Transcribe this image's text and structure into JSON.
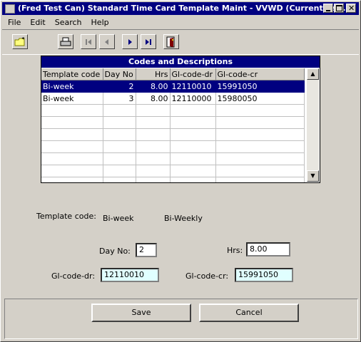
{
  "window": {
    "title": "(Fred Test Can) Standard Time Card Template Maint - VVWD (Current Us..."
  },
  "menu": [
    {
      "label": "File"
    },
    {
      "label": "Edit"
    },
    {
      "label": "Search"
    },
    {
      "label": "Help"
    }
  ],
  "toolbar": {
    "icons": [
      "open-folder-icon",
      "print-icon",
      "first-record-icon",
      "previous-record-icon",
      "next-record-icon",
      "last-record-icon",
      "exit-door-icon"
    ]
  },
  "grid": {
    "title": "Codes and Descriptions",
    "columns": [
      "Template code",
      "Day No",
      "Hrs",
      "Gl-code-dr",
      "Gl-code-cr"
    ],
    "rows": [
      {
        "template_code": "Bi-week",
        "day_no": "2",
        "hrs": "8.00",
        "gl_dr": "12110010",
        "gl_cr": "15991050",
        "selected": true
      },
      {
        "template_code": "Bi-week",
        "day_no": "3",
        "hrs": "8.00",
        "gl_dr": "12110000",
        "gl_cr": "15980050",
        "selected": false
      }
    ]
  },
  "form": {
    "template_code_label": "Template code:",
    "template_code_value": "Bi-week",
    "template_code_desc": "Bi-Weekly",
    "day_no_label": "Day No:",
    "day_no_value": "2",
    "hrs_label": "Hrs:",
    "hrs_value": "8.00",
    "gl_dr_label": "Gl-code-dr:",
    "gl_dr_value": "12110010",
    "gl_cr_label": "Gl-code-cr:",
    "gl_cr_value": "15991050"
  },
  "buttons": {
    "save": "Save",
    "cancel": "Cancel"
  }
}
